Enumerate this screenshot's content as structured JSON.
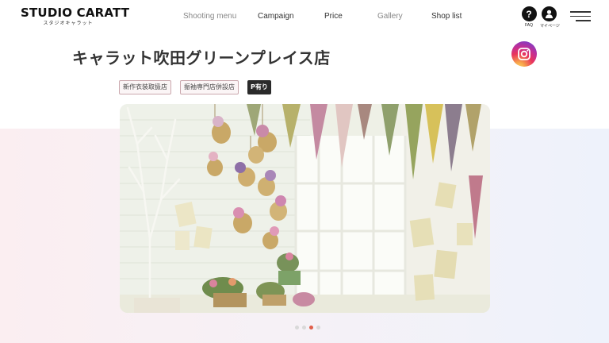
{
  "brand": {
    "name": "STUDIO CARATT",
    "subtitle": "スタジオキャラット"
  },
  "nav": {
    "items": [
      {
        "label": "Shooting menu"
      },
      {
        "label": "Campaign"
      },
      {
        "label": "Price"
      },
      {
        "label": "Gallery"
      },
      {
        "label": "Shop list"
      }
    ],
    "faq_label": "FAQ",
    "mypage_label": "マイページ"
  },
  "page": {
    "title": "キャラット吹田グリーンプレイス店",
    "tags": [
      {
        "label": "新作衣装取扱店"
      },
      {
        "label": "振袖専門店併設店"
      },
      {
        "label": "P有り"
      }
    ]
  },
  "carousel": {
    "slide_count": 4,
    "active_index": 2
  },
  "colors": {
    "accent_dot": "#e05f4b",
    "tag_border": "#caa7ad",
    "text": "#333333"
  },
  "icons": [
    "faq-question-icon",
    "mypage-person-icon",
    "hamburger-menu-icon",
    "instagram-icon"
  ]
}
